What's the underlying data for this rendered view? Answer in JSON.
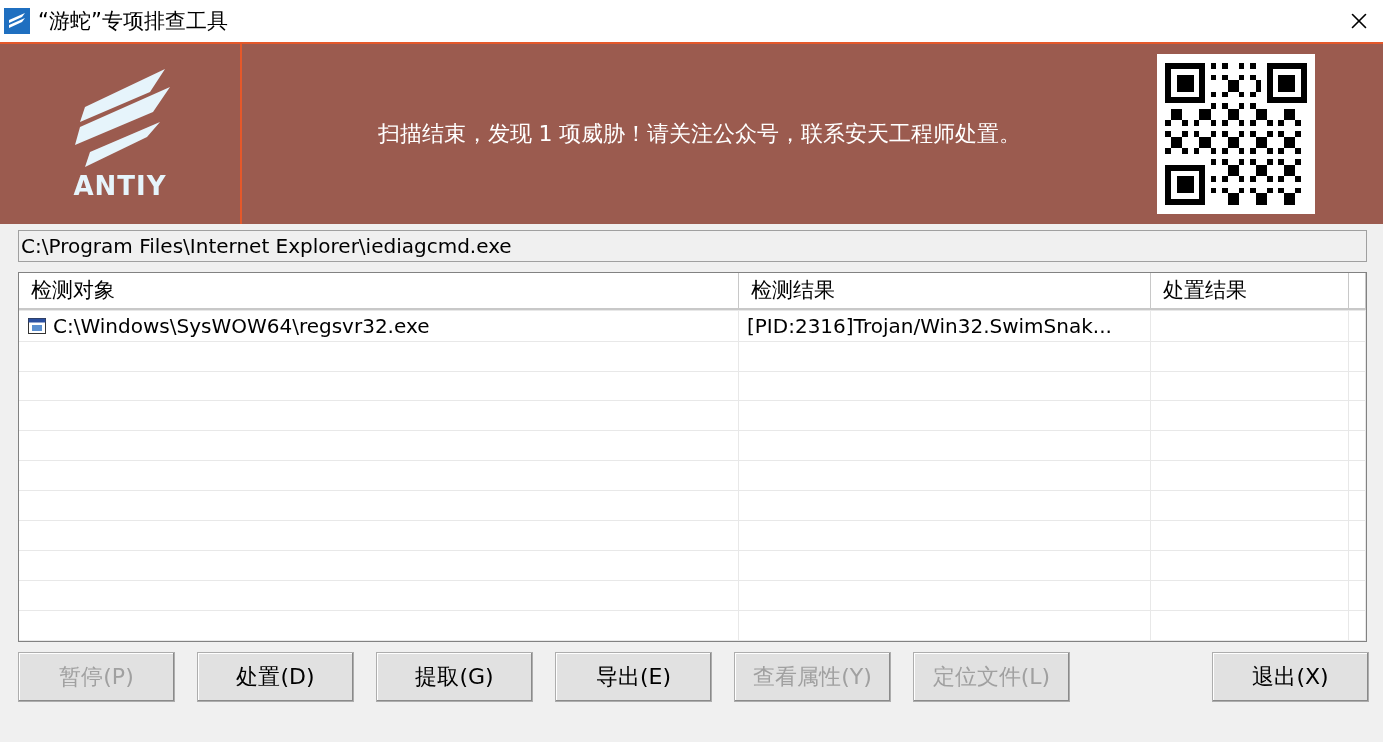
{
  "window": {
    "title": "“游蛇”专项排查工具"
  },
  "header": {
    "logo_text": "ANTIY",
    "message": "扫描结束，发现 1 项威胁！请关注公众号，联系安天工程师处置。"
  },
  "current_path": "C:\\Program Files\\Internet Explorer\\iediagcmd.exe",
  "table": {
    "columns": [
      "检测对象",
      "检测结果",
      "处置结果"
    ],
    "rows": [
      {
        "object": "C:\\Windows\\SysWOW64\\regsvr32.exe",
        "result": "[PID:2316]Trojan/Win32.SwimSnak..."
      }
    ]
  },
  "buttons": [
    {
      "label": "暂停(P)",
      "disabled": true
    },
    {
      "label": "处置(D)",
      "disabled": false
    },
    {
      "label": "提取(G)",
      "disabled": false
    },
    {
      "label": "导出(E)",
      "disabled": false
    },
    {
      "label": "查看属性(Y)",
      "disabled": true
    },
    {
      "label": "定位文件(L)",
      "disabled": true
    },
    {
      "label": "退出(X)",
      "disabled": false
    }
  ]
}
